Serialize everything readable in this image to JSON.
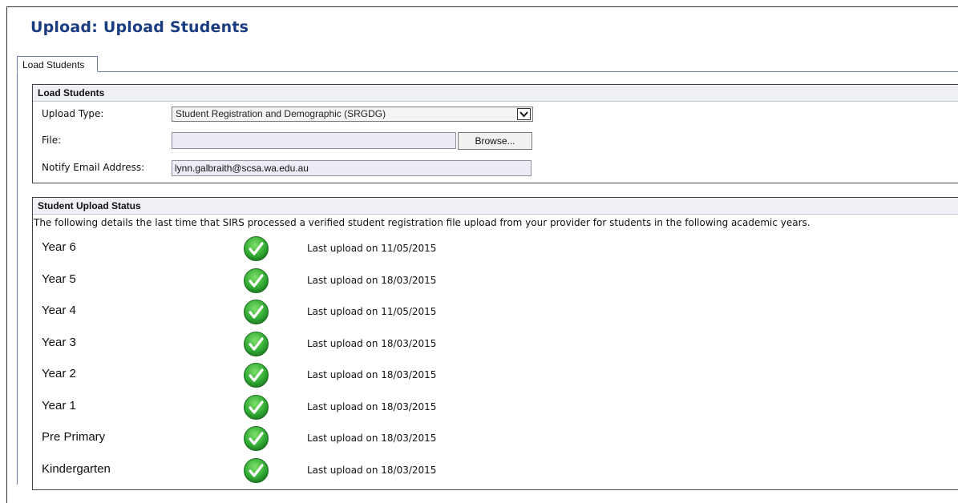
{
  "page": {
    "title": "Upload: Upload Students"
  },
  "tabs": [
    {
      "label": "Load Students"
    }
  ],
  "load_panel": {
    "header": "Load Students",
    "upload_type": {
      "label": "Upload Type:",
      "value": "Student Registration and Demographic (SRGDG)"
    },
    "file": {
      "label": "File:",
      "value": "",
      "browse_label": "Browse..."
    },
    "email": {
      "label": "Notify Email Address:",
      "value": "lynn.galbraith@scsa.wa.edu.au"
    }
  },
  "status_panel": {
    "header": "Student Upload Status",
    "description": "The following details the last time that SIRS processed a verified student registration file upload from your provider for students in the following academic years.",
    "rows": [
      {
        "year": "Year 6",
        "status_icon": "check-circle-icon",
        "text": "Last upload on 11/05/2015"
      },
      {
        "year": "Year 5",
        "status_icon": "check-circle-icon",
        "text": "Last upload on 18/03/2015"
      },
      {
        "year": "Year 4",
        "status_icon": "check-circle-icon",
        "text": "Last upload on 11/05/2015"
      },
      {
        "year": "Year 3",
        "status_icon": "check-circle-icon",
        "text": "Last upload on 18/03/2015"
      },
      {
        "year": "Year 2",
        "status_icon": "check-circle-icon",
        "text": "Last upload on 18/03/2015"
      },
      {
        "year": "Year 1",
        "status_icon": "check-circle-icon",
        "text": "Last upload on 18/03/2015"
      },
      {
        "year": "Pre Primary",
        "status_icon": "check-circle-icon",
        "text": "Last upload on 18/03/2015"
      },
      {
        "year": "Kindergarten",
        "status_icon": "check-circle-icon",
        "text": "Last upload on 18/03/2015"
      }
    ]
  },
  "colors": {
    "title": "#1b3c80",
    "success_green": "#2fa832",
    "panel_header_bg": "#eef0f5"
  }
}
